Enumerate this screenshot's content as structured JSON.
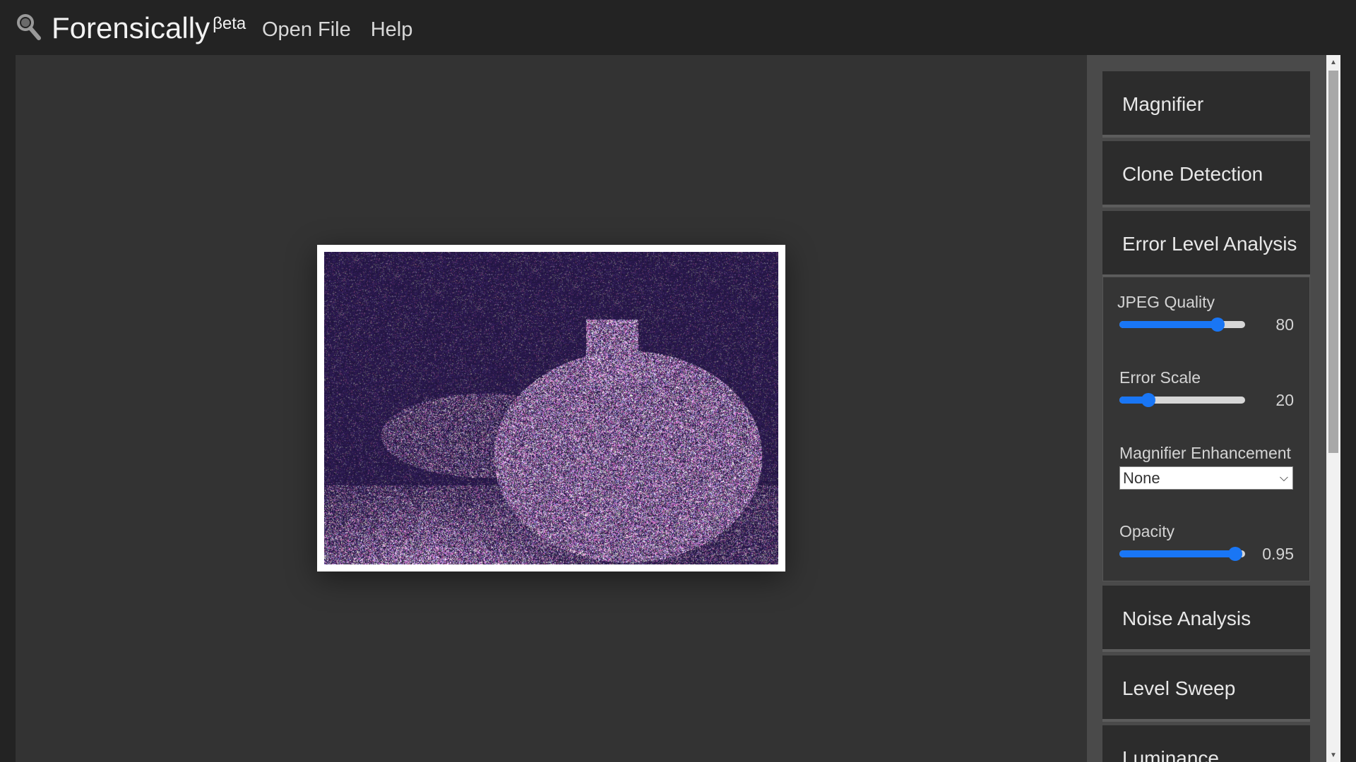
{
  "app": {
    "title": "Forensically",
    "badge": "Beta"
  },
  "nav": {
    "open_file": "Open File",
    "help": "Help"
  },
  "tools": {
    "magnifier": "Magnifier",
    "clone_detection": "Clone Detection",
    "error_level_analysis": "Error Level Analysis",
    "noise_analysis": "Noise Analysis",
    "level_sweep": "Level Sweep",
    "luminance": "Luminance"
  },
  "ela_panel": {
    "jpeg_quality": {
      "label": "JPEG Quality",
      "value": "80",
      "fraction": 0.78
    },
    "error_scale": {
      "label": "Error Scale",
      "value": "20",
      "fraction": 0.23
    },
    "magnifier_enhancement": {
      "label": "Magnifier Enhancement",
      "selected": "None"
    },
    "opacity": {
      "label": "Opacity",
      "value": "0.95",
      "fraction": 0.92
    }
  },
  "colors": {
    "accent": "#1976f5",
    "header_bg": "#232323",
    "workspace_bg": "#333333",
    "sidebar_bg": "#4a4a4a",
    "tool_bg": "#2c2c2c"
  },
  "icons": {
    "logo": "magnifier-icon"
  }
}
